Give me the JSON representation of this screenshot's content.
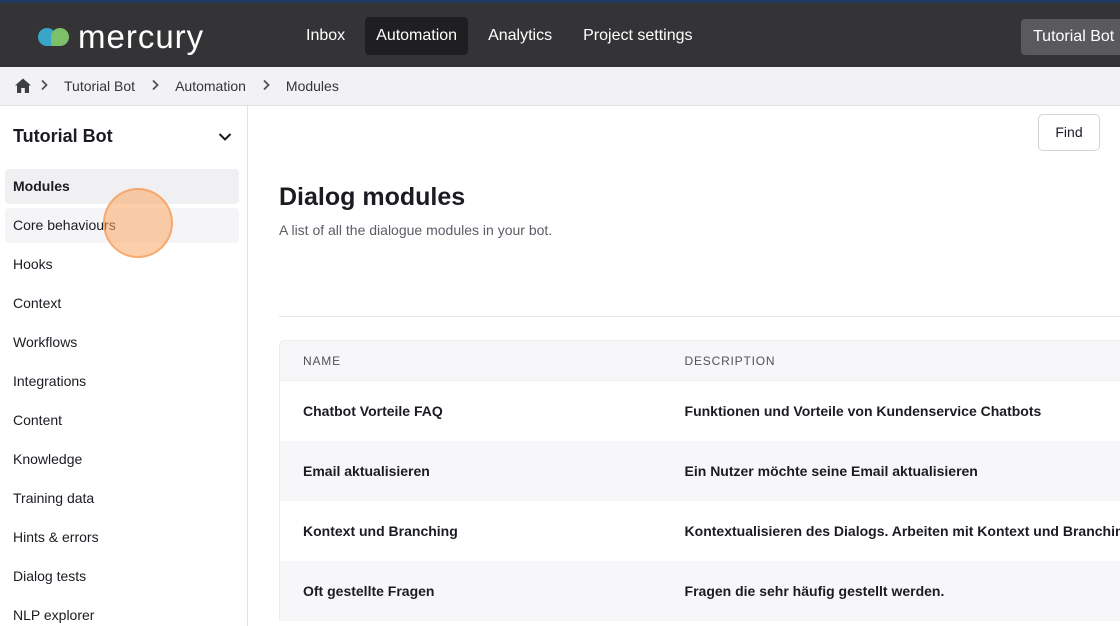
{
  "app": {
    "logo_text": "mercury",
    "nav": [
      "Inbox",
      "Automation",
      "Analytics",
      "Project settings"
    ],
    "active_nav": "Automation",
    "bot_switcher_label": "Tutorial Bot"
  },
  "breadcrumb": {
    "items": [
      "Tutorial Bot",
      "Automation",
      "Modules"
    ]
  },
  "sidebar": {
    "title": "Tutorial Bot",
    "items": [
      {
        "label": "Modules"
      },
      {
        "label": "Core behaviours"
      },
      {
        "label": "Hooks"
      },
      {
        "label": "Context"
      },
      {
        "label": "Workflows"
      },
      {
        "label": "Integrations"
      },
      {
        "label": "Content"
      },
      {
        "label": "Knowledge"
      },
      {
        "label": "Training data"
      },
      {
        "label": "Hints & errors"
      },
      {
        "label": "Dialog tests"
      },
      {
        "label": "NLP explorer"
      }
    ],
    "active_item": "Modules",
    "hovered_item": "Core behaviours"
  },
  "main": {
    "find_label": "Find",
    "title": "Dialog modules",
    "subtitle": "A list of all the dialogue modules in your bot.",
    "table": {
      "columns": [
        "NAME",
        "DESCRIPTION"
      ],
      "rows": [
        {
          "name": "Chatbot Vorteile FAQ",
          "description": "Funktionen und Vorteile von Kundenservice Chatbots"
        },
        {
          "name": "Email aktualisieren",
          "description": "Ein Nutzer möchte seine Email aktualisieren"
        },
        {
          "name": "Kontext und Branching",
          "description": "Kontextualisieren des Dialogs. Arbeiten mit Kontext und Branching"
        },
        {
          "name": "Oft gestellte Fragen",
          "description": "Fragen die sehr häufig gestellt werden."
        }
      ]
    }
  },
  "colors": {
    "topbar": "#343437",
    "accent_blue": "#39a6c9",
    "accent_green": "#7cc06a",
    "click_marker": "#f9a562"
  },
  "icons": [
    "home-icon",
    "chevron-right-icon",
    "chevron-down-icon"
  ]
}
